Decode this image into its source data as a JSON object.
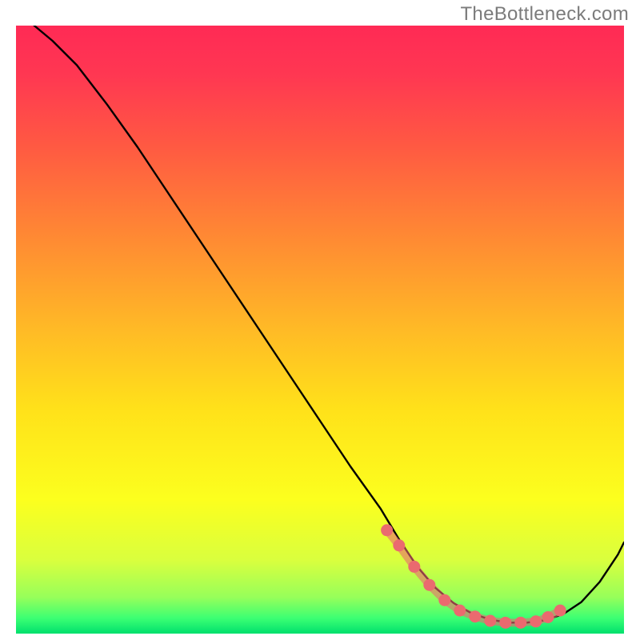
{
  "watermark": "TheBottleneck.com",
  "chart_data": {
    "type": "line",
    "title": "",
    "xlabel": "",
    "ylabel": "",
    "xlim": [
      0,
      100
    ],
    "ylim": [
      0,
      100
    ],
    "gradient_stops": [
      {
        "offset": 0.0,
        "color": "#ff2a55"
      },
      {
        "offset": 0.08,
        "color": "#ff3752"
      },
      {
        "offset": 0.2,
        "color": "#ff5a42"
      },
      {
        "offset": 0.35,
        "color": "#ff8a33"
      },
      {
        "offset": 0.5,
        "color": "#ffba26"
      },
      {
        "offset": 0.63,
        "color": "#ffe11a"
      },
      {
        "offset": 0.78,
        "color": "#fcff1e"
      },
      {
        "offset": 0.88,
        "color": "#d9ff3e"
      },
      {
        "offset": 0.94,
        "color": "#97ff5a"
      },
      {
        "offset": 0.975,
        "color": "#3bff73"
      },
      {
        "offset": 1.0,
        "color": "#00e06d"
      }
    ],
    "series": [
      {
        "name": "curve",
        "x": [
          3,
          6,
          10,
          15,
          20,
          25,
          30,
          35,
          40,
          45,
          50,
          55,
          60,
          63,
          66,
          69,
          72,
          75,
          78,
          81,
          84,
          87,
          90,
          93,
          96,
          99,
          100
        ],
        "y": [
          100,
          97.5,
          93.5,
          87,
          80,
          72.5,
          65,
          57.5,
          50,
          42.5,
          35,
          27.5,
          20.5,
          15.5,
          11,
          7.5,
          5,
          3.3,
          2.3,
          1.8,
          1.8,
          2.2,
          3.2,
          5.2,
          8.5,
          13,
          15
        ]
      },
      {
        "name": "marker-band",
        "x": [
          61,
          63,
          65.5,
          68,
          70.5,
          73,
          75.5,
          78,
          80.5,
          83,
          85.5,
          87.5,
          89.5
        ],
        "y": [
          17,
          14.5,
          11,
          8,
          5.5,
          3.8,
          2.8,
          2.1,
          1.8,
          1.8,
          2.0,
          2.7,
          3.8
        ]
      }
    ],
    "marker_color": "#ea6a6f",
    "curve_color": "#000000"
  }
}
